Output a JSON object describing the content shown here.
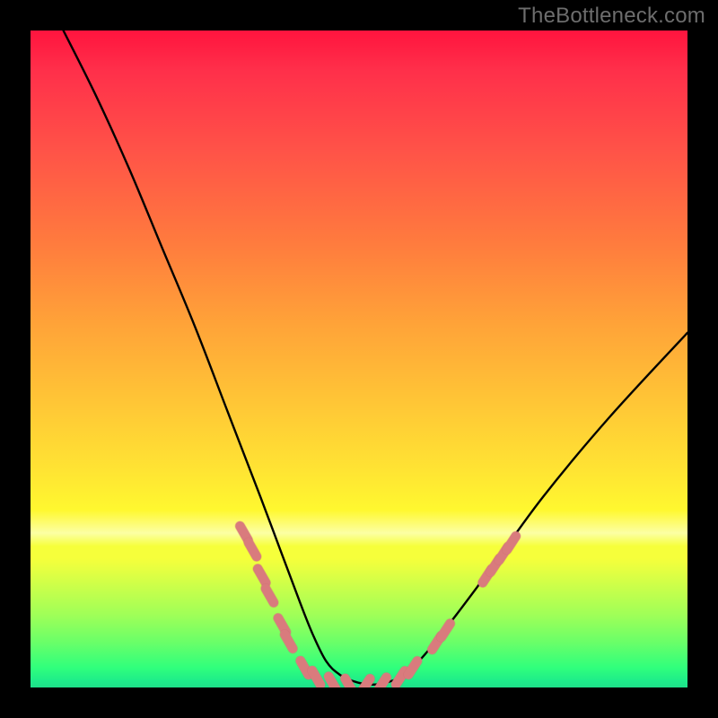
{
  "watermark": "TheBottleneck.com",
  "colors": {
    "page_bg": "#000000",
    "watermark": "#6d6d6d",
    "curve_stroke": "#000000",
    "marker_fill": "#d97b7d",
    "marker_stroke": "#c96a6e",
    "gradient_top": "#ff143e",
    "gradient_bottom": "#1ee089"
  },
  "chart_data": {
    "type": "line",
    "title": "",
    "xlabel": "",
    "ylabel": "",
    "xlim": [
      0,
      100
    ],
    "ylim": [
      0,
      100
    ],
    "grid": false,
    "legend": false,
    "series": [
      {
        "name": "bottleneck-curve",
        "x": [
          5,
          10,
          15,
          20,
          25,
          30,
          35,
          38,
          41,
          43,
          45,
          47,
          49,
          51,
          53,
          55,
          57,
          60,
          64,
          70,
          78,
          88,
          100
        ],
        "y": [
          100,
          90,
          79,
          67,
          55,
          42,
          29,
          21,
          13,
          8,
          4,
          2,
          1,
          0.5,
          0.5,
          1,
          2,
          5,
          10,
          18,
          29,
          41,
          54
        ]
      }
    ],
    "markers": [
      {
        "x": 32.5,
        "y": 23.5
      },
      {
        "x": 33.8,
        "y": 21.0
      },
      {
        "x": 35.2,
        "y": 17.0
      },
      {
        "x": 36.4,
        "y": 14.0
      },
      {
        "x": 38.3,
        "y": 9.5
      },
      {
        "x": 39.3,
        "y": 7.0
      },
      {
        "x": 41.7,
        "y": 3.0
      },
      {
        "x": 43.5,
        "y": 1.5
      },
      {
        "x": 46.0,
        "y": 0.6
      },
      {
        "x": 48.5,
        "y": 0.3
      },
      {
        "x": 51.0,
        "y": 0.3
      },
      {
        "x": 53.5,
        "y": 0.5
      },
      {
        "x": 56.3,
        "y": 1.5
      },
      {
        "x": 58.2,
        "y": 3.0
      },
      {
        "x": 61.8,
        "y": 6.8
      },
      {
        "x": 63.2,
        "y": 8.7
      },
      {
        "x": 69.5,
        "y": 17.0
      },
      {
        "x": 70.7,
        "y": 18.6
      },
      {
        "x": 72.0,
        "y": 20.4
      },
      {
        "x": 73.2,
        "y": 22.0
      }
    ],
    "annotations": []
  }
}
